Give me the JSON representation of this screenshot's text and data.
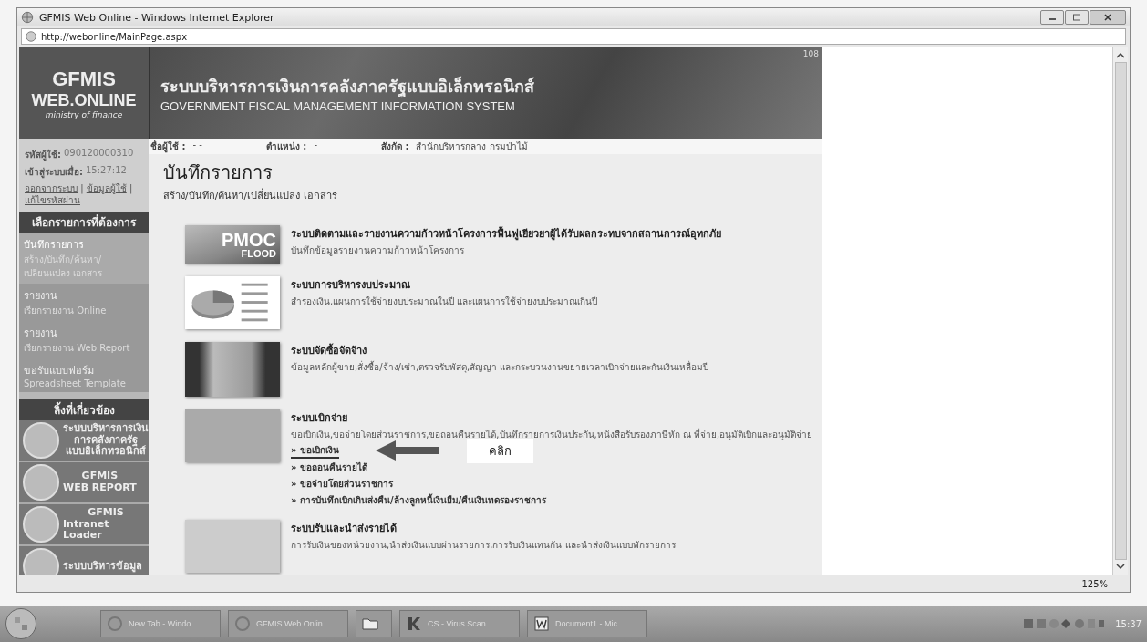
{
  "window": {
    "title": "GFMIS Web Online - Windows Internet Explorer",
    "address": "http://webonline/MainPage.aspx"
  },
  "banner": {
    "logo_lines": [
      "GFMIS",
      "WEB.ONLINE",
      "ministry of finance"
    ],
    "title_th": "ระบบบริหารการเงินการคลังภาครัฐแบบอิเล็กทรอนิกส์",
    "title_en": "GOVERNMENT FISCAL MANAGEMENT INFORMATION SYSTEM",
    "code": "108"
  },
  "user_info": {
    "user_id_label": "รหัสผู้ใช้:",
    "user_id": "090120000310",
    "login_label": "เข้าสู่ระบบเมื่อ:",
    "login_time": "15:27:12",
    "links": [
      "ออกจากระบบ",
      "ข้อมูลผู้ใช้",
      "แก้ไขรหัสผ่าน"
    ],
    "separator": "|"
  },
  "menu": {
    "heading": "เลือกรายการที่ต้องการ",
    "items": [
      {
        "title": "บันทึกรายการ",
        "subtitle": "สร้าง/บันทึก/ค้นหา/เปลี่ยนแปลง เอกสาร",
        "selected": true
      },
      {
        "title": "รายงาน",
        "subtitle": "เรียกรายงาน Online",
        "selected": false
      },
      {
        "title": "รายงาน",
        "subtitle": "เรียกรายงาน Web Report",
        "selected": false
      },
      {
        "title": "ขอรับแบบฟอร์ม",
        "subtitle": "Spreadsheet Template",
        "selected": false
      }
    ]
  },
  "related_links": {
    "heading": "ลิ้งที่เกี่ยวข้อง",
    "items": [
      {
        "lines": [
          "ระบบบริหารการเงิน",
          "การคลังภาครัฐ",
          "แบบอิเล็กทรอนิกส์"
        ]
      },
      {
        "lines": [
          "GFMIS",
          "WEB REPORT"
        ]
      },
      {
        "lines": [
          "GFMIS",
          "Intranet Loader"
        ]
      },
      {
        "lines": [
          "ระบบบริหารข้อมูล"
        ]
      }
    ]
  },
  "info_bar": [
    {
      "label": "ชื่อผู้ใช้ :",
      "value": "- -"
    },
    {
      "label": "ตำแหน่ง :",
      "value": "-"
    },
    {
      "label": "สังกัด :",
      "value": "สำนักบริหารกลาง กรมป่าไม้"
    }
  ],
  "page": {
    "title": "บันทึกรายการ",
    "subtitle": "สร้าง/บันทึก/ค้นหา/เปลี่ยนแปลง เอกสาร"
  },
  "modules": [
    {
      "kind": "pmoc",
      "image_text": [
        "PMOC",
        "FLOOD"
      ],
      "title": "ระบบติดตามและรายงานความก้าวหน้าโครงการฟื้นฟูเยียวยาผู้ได้รับผลกระทบจากสถานการณ์อุทกภัย",
      "description": "บันทึกข้อมูลรายงานความก้าวหน้าโครงการ"
    },
    {
      "kind": "pie",
      "title": "ระบบการบริหารงบประมาณ",
      "description": "สำรองเงิน,แผนการใช้จ่ายงบประมาณในปี และแผนการใช้จ่ายงบประมาณเกินปี"
    },
    {
      "kind": "handshake",
      "title": "ระบบจัดซื้อจัดจ้าง",
      "description": "ข้อมูลหลักผู้ขาย,สั่งซื้อ/จ้าง/เช่า,ตรวจรับพัสดุ,สัญญา และกระบวนงานขยายเวลาเบิกจ่ายและกันเงินเหลื่อมปี"
    },
    {
      "kind": "money",
      "title": "ระบบเบิกจ่าย",
      "description": "ขอเบิกเงิน,ขอจ่ายโดยส่วนราชการ,ขอถอนคืนรายได้,บันทึกรายการเงินประกัน,หนังสือรับรองภาษีหัก ณ ที่จ่าย,อนุมัติเบิกและอนุมัติจ่าย",
      "links": [
        {
          "text": "» ขอเบิกเงิน",
          "highlighted": true
        },
        {
          "text": "» ขอถอนคืนรายได้",
          "highlighted": false
        },
        {
          "text": "» ขอจ่ายโดยส่วนราชการ",
          "highlighted": false
        },
        {
          "text": "» การบันทึกเบิกเกินส่งคืน/ล้างลูกหนี้เงินยืม/คืนเงินทดรองราชการ",
          "highlighted": false
        }
      ]
    },
    {
      "kind": "documents",
      "title": "ระบบรับและนำส่งรายได้",
      "description": "การรับเงินของหน่วยงาน,นำส่งเงินแบบผ่านรายการ,การรับเงินแทนกัน และนำส่งเงินแบบพักรายการ"
    }
  ],
  "annotation": {
    "text": "คลิก"
  },
  "status_bar": {
    "zoom": "125%"
  },
  "taskbar": {
    "items": [
      {
        "kind": "ie",
        "label": "New Tab - Windo..."
      },
      {
        "kind": "ie",
        "label": "GFMIS Web Onlin..."
      },
      {
        "kind": "folder"
      },
      {
        "kind": "k",
        "label": "CS - Virus Scan"
      },
      {
        "kind": "word",
        "label": "Document1 - Mic..."
      }
    ],
    "clock": "15:37"
  }
}
